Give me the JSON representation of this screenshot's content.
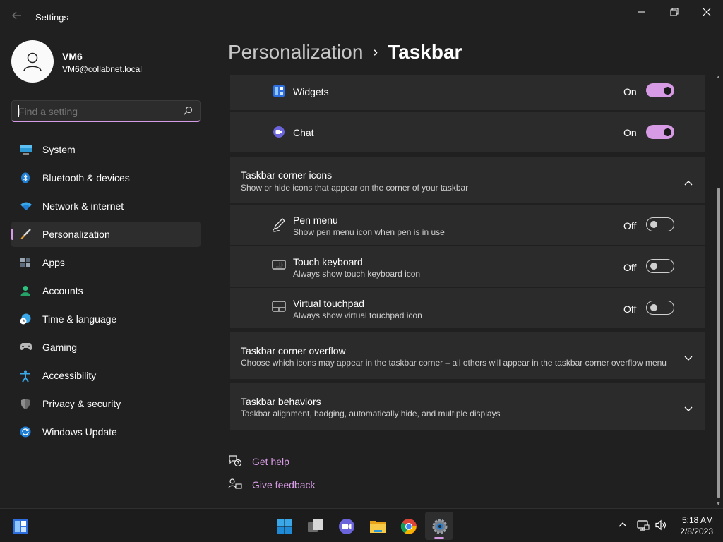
{
  "window": {
    "title": "Settings"
  },
  "profile": {
    "name": "VM6",
    "email": "VM6@collabnet.local"
  },
  "search": {
    "placeholder": "Find a setting"
  },
  "sidebar": {
    "items": [
      {
        "label": "System",
        "icon": "system-icon"
      },
      {
        "label": "Bluetooth & devices",
        "icon": "bluetooth-icon"
      },
      {
        "label": "Network & internet",
        "icon": "wifi-icon"
      },
      {
        "label": "Personalization",
        "icon": "brush-icon",
        "active": true
      },
      {
        "label": "Apps",
        "icon": "apps-icon"
      },
      {
        "label": "Accounts",
        "icon": "accounts-icon"
      },
      {
        "label": "Time & language",
        "icon": "clock-globe-icon"
      },
      {
        "label": "Gaming",
        "icon": "controller-icon"
      },
      {
        "label": "Accessibility",
        "icon": "accessibility-icon"
      },
      {
        "label": "Privacy & security",
        "icon": "shield-icon"
      },
      {
        "label": "Windows Update",
        "icon": "update-icon"
      }
    ]
  },
  "breadcrumb": {
    "parent": "Personalization",
    "separator": "›",
    "current": "Taskbar"
  },
  "taskbar_items": [
    {
      "title": "Widgets",
      "state": "On",
      "on": true,
      "icon": "widgets-icon"
    },
    {
      "title": "Chat",
      "state": "On",
      "on": true,
      "icon": "chat-icon"
    }
  ],
  "corner_icons": {
    "title": "Taskbar corner icons",
    "description": "Show or hide icons that appear on the corner of your taskbar",
    "expanded": true,
    "items": [
      {
        "title": "Pen menu",
        "description": "Show pen menu icon when pen is in use",
        "state": "Off",
        "on": false,
        "icon": "pen-icon"
      },
      {
        "title": "Touch keyboard",
        "description": "Always show touch keyboard icon",
        "state": "Off",
        "on": false,
        "icon": "keyboard-icon"
      },
      {
        "title": "Virtual touchpad",
        "description": "Always show virtual touchpad icon",
        "state": "Off",
        "on": false,
        "icon": "touchpad-icon"
      }
    ]
  },
  "corner_overflow": {
    "title": "Taskbar corner overflow",
    "description": "Choose which icons may appear in the taskbar corner – all others will appear in the taskbar corner overflow menu"
  },
  "behaviors": {
    "title": "Taskbar behaviors",
    "description": "Taskbar alignment, badging, automatically hide, and multiple displays"
  },
  "help": {
    "get_help": "Get help",
    "give_feedback": "Give feedback"
  },
  "system_taskbar": {
    "time": "5:18 AM",
    "date": "2/8/2023",
    "apps": [
      "windows-start-icon",
      "task-view-icon",
      "teams-chat-icon",
      "file-explorer-icon",
      "chrome-icon",
      "settings-gear-icon"
    ]
  },
  "colors": {
    "accent": "#d79be5",
    "background": "#202020",
    "card": "#2b2b2b"
  }
}
